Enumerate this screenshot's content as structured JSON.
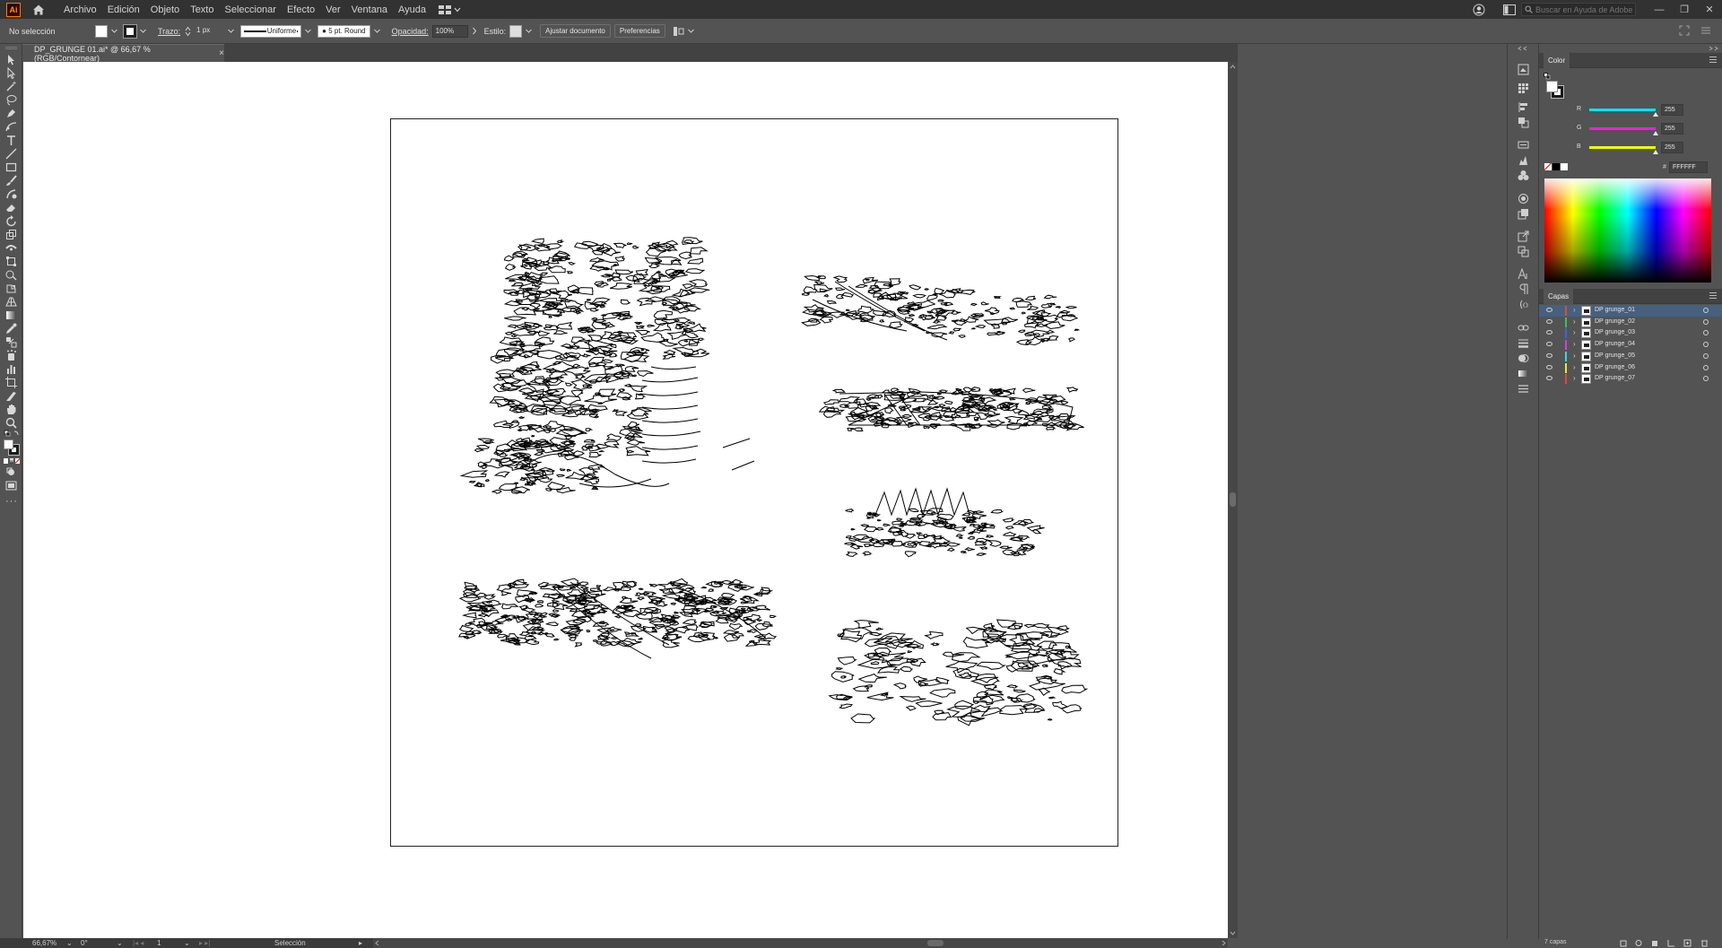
{
  "app": {
    "logo_text": "Ai"
  },
  "menu": [
    "Archivo",
    "Edición",
    "Objeto",
    "Texto",
    "Seleccionar",
    "Efecto",
    "Ver",
    "Ventana",
    "Ayuda"
  ],
  "help_search": {
    "placeholder": "Buscar en Ayuda de Adobe"
  },
  "control_bar": {
    "selection_status": "No selección",
    "stroke_label": "Trazo:",
    "stroke_weight": "1 px",
    "stroke_profile": "Uniforme",
    "brush": "5 pt. Round",
    "opacity_label": "Opacidad:",
    "opacity_value": "100%",
    "style_label": "Estilo:",
    "adjust_document": "Ajustar documento",
    "preferences": "Preferencias"
  },
  "document_tab": {
    "title": "DP_GRUNGE 01.ai* @ 66,67 % (RGB/Contornear)",
    "close": "×"
  },
  "status_bar": {
    "zoom": "66,67%",
    "rotation": "0°",
    "artboard_number": "1",
    "tool_name": "Selección"
  },
  "color_panel": {
    "tab": "Color",
    "channels": [
      {
        "label": "R",
        "value": "255",
        "color": "#00e5ff"
      },
      {
        "label": "G",
        "value": "255",
        "color": "#ff1ad9"
      },
      {
        "label": "B",
        "value": "255",
        "color": "#f2ff00"
      }
    ],
    "hex_label": "#",
    "hex_value": "FFFFFF"
  },
  "layers_panel": {
    "tab": "Capas",
    "layers": [
      {
        "name": "DP grunge_01",
        "color": "#e8463a",
        "selected": true
      },
      {
        "name": "DP grunge_02",
        "color": "#3fc04b",
        "selected": false
      },
      {
        "name": "DP grunge_03",
        "color": "#3a63e8",
        "selected": false
      },
      {
        "name": "DP grunge_04",
        "color": "#d23fe0",
        "selected": false
      },
      {
        "name": "DP grunge_05",
        "color": "#37d8e6",
        "selected": false
      },
      {
        "name": "DP grunge_06",
        "color": "#f0e23a",
        "selected": false
      },
      {
        "name": "DP grunge_07",
        "color": "#e8463a",
        "selected": false
      }
    ],
    "footer_count": "7 capas"
  },
  "colors": {
    "accent_selection": "#46607e"
  }
}
